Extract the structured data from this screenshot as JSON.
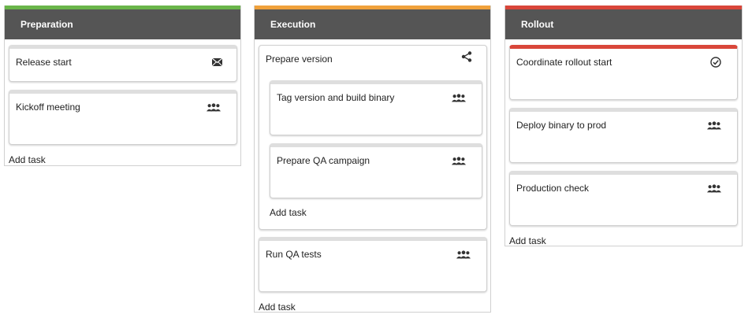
{
  "colors": {
    "header_bg": "#555555",
    "preparation_accent": "#6ab54a",
    "execution_accent": "#f0a13b",
    "rollout_accent": "#d9463a"
  },
  "columns": [
    {
      "title": "Preparation",
      "tasks": [
        {
          "label": "Release start",
          "icon": "envelope-icon"
        },
        {
          "label": "Kickoff meeting",
          "icon": "users-icon"
        }
      ],
      "add_task": "Add task"
    },
    {
      "title": "Execution",
      "group": {
        "label": "Prepare version",
        "icon": "share-icon",
        "tasks": [
          {
            "label": "Tag version and build binary",
            "icon": "users-icon"
          },
          {
            "label": "Prepare QA campaign",
            "icon": "users-icon"
          }
        ],
        "add_task": "Add task"
      },
      "tasks": [
        {
          "label": "Run QA tests",
          "icon": "users-icon"
        }
      ],
      "add_task": "Add task"
    },
    {
      "title": "Rollout",
      "tasks": [
        {
          "label": "Coordinate rollout start",
          "icon": "check-circle-icon"
        },
        {
          "label": "Deploy binary to prod",
          "icon": "users-icon"
        },
        {
          "label": "Production check",
          "icon": "users-icon"
        }
      ],
      "add_task": "Add task"
    }
  ]
}
